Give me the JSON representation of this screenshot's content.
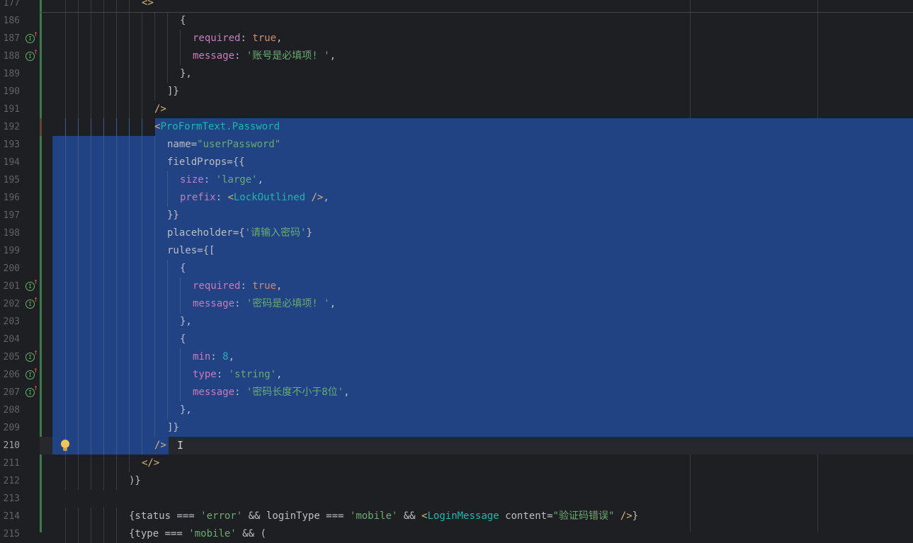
{
  "editor": {
    "lines": [
      {
        "n": "177",
        "indent": 7,
        "tokens": [
          {
            "t": "<>",
            "c": "tag"
          }
        ]
      },
      {
        "n": "186",
        "indent": 10,
        "tokens": [
          {
            "t": "{",
            "c": "punc"
          }
        ]
      },
      {
        "n": "187",
        "indent": 11,
        "marker": true,
        "tokens": [
          {
            "t": "required",
            "c": "key"
          },
          {
            "t": ": ",
            "c": "punc"
          },
          {
            "t": "true",
            "c": "kw"
          },
          {
            "t": ",",
            "c": "punc"
          }
        ]
      },
      {
        "n": "188",
        "indent": 11,
        "marker": true,
        "tokens": [
          {
            "t": "message",
            "c": "key"
          },
          {
            "t": ": ",
            "c": "punc"
          },
          {
            "t": "'账号是必填项! '",
            "c": "str"
          },
          {
            "t": ",",
            "c": "punc"
          }
        ]
      },
      {
        "n": "189",
        "indent": 10,
        "tokens": [
          {
            "t": "},",
            "c": "punc"
          }
        ]
      },
      {
        "n": "190",
        "indent": 9,
        "tokens": [
          {
            "t": "]}",
            "c": "punc"
          }
        ]
      },
      {
        "n": "191",
        "indent": 8,
        "tokens": [
          {
            "t": "/>",
            "c": "tag"
          }
        ]
      },
      {
        "n": "192",
        "indent": 8,
        "selected": true,
        "selStart": 8,
        "tokens": [
          {
            "t": "<",
            "c": "tag"
          },
          {
            "t": "ProFormText.Password",
            "c": "comp"
          }
        ]
      },
      {
        "n": "193",
        "indent": 9,
        "selected": true,
        "tokens": [
          {
            "t": "name",
            "c": "attr"
          },
          {
            "t": "=",
            "c": "punc"
          },
          {
            "t": "\"userPassword\"",
            "c": "str"
          }
        ]
      },
      {
        "n": "194",
        "indent": 9,
        "selected": true,
        "tokens": [
          {
            "t": "fieldProps",
            "c": "attr"
          },
          {
            "t": "={{",
            "c": "punc"
          }
        ]
      },
      {
        "n": "195",
        "indent": 10,
        "selected": true,
        "tokens": [
          {
            "t": "size",
            "c": "key"
          },
          {
            "t": ": ",
            "c": "punc"
          },
          {
            "t": "'large'",
            "c": "str"
          },
          {
            "t": ",",
            "c": "punc"
          }
        ]
      },
      {
        "n": "196",
        "indent": 10,
        "selected": true,
        "tokens": [
          {
            "t": "prefix",
            "c": "key"
          },
          {
            "t": ": ",
            "c": "punc"
          },
          {
            "t": "<",
            "c": "tag"
          },
          {
            "t": "LockOutlined",
            "c": "comp"
          },
          {
            "t": " />",
            "c": "tag"
          },
          {
            "t": ",",
            "c": "punc"
          }
        ]
      },
      {
        "n": "197",
        "indent": 9,
        "selected": true,
        "tokens": [
          {
            "t": "}}",
            "c": "punc"
          }
        ]
      },
      {
        "n": "198",
        "indent": 9,
        "selected": true,
        "tokens": [
          {
            "t": "placeholder",
            "c": "attr"
          },
          {
            "t": "={",
            "c": "punc"
          },
          {
            "t": "'请输入密码'",
            "c": "str"
          },
          {
            "t": "}",
            "c": "punc"
          }
        ]
      },
      {
        "n": "199",
        "indent": 9,
        "selected": true,
        "tokens": [
          {
            "t": "rules",
            "c": "attr"
          },
          {
            "t": "={[",
            "c": "punc"
          }
        ]
      },
      {
        "n": "200",
        "indent": 10,
        "selected": true,
        "tokens": [
          {
            "t": "{",
            "c": "punc"
          }
        ]
      },
      {
        "n": "201",
        "indent": 11,
        "marker": true,
        "selected": true,
        "tokens": [
          {
            "t": "required",
            "c": "key"
          },
          {
            "t": ": ",
            "c": "punc"
          },
          {
            "t": "true",
            "c": "kw"
          },
          {
            "t": ",",
            "c": "punc"
          }
        ]
      },
      {
        "n": "202",
        "indent": 11,
        "marker": true,
        "selected": true,
        "tokens": [
          {
            "t": "message",
            "c": "key"
          },
          {
            "t": ": ",
            "c": "punc"
          },
          {
            "t": "'密码是必填项! '",
            "c": "str"
          },
          {
            "t": ",",
            "c": "punc"
          }
        ]
      },
      {
        "n": "203",
        "indent": 10,
        "selected": true,
        "tokens": [
          {
            "t": "},",
            "c": "punc"
          }
        ]
      },
      {
        "n": "204",
        "indent": 10,
        "selected": true,
        "tokens": [
          {
            "t": "{",
            "c": "punc"
          }
        ]
      },
      {
        "n": "205",
        "indent": 11,
        "marker": true,
        "selected": true,
        "tokens": [
          {
            "t": "min",
            "c": "key"
          },
          {
            "t": ": ",
            "c": "punc"
          },
          {
            "t": "8",
            "c": "num"
          },
          {
            "t": ",",
            "c": "punc"
          }
        ]
      },
      {
        "n": "206",
        "indent": 11,
        "marker": true,
        "selected": true,
        "tokens": [
          {
            "t": "type",
            "c": "key"
          },
          {
            "t": ": ",
            "c": "punc"
          },
          {
            "t": "'string'",
            "c": "str"
          },
          {
            "t": ",",
            "c": "punc"
          }
        ]
      },
      {
        "n": "207",
        "indent": 11,
        "marker": true,
        "selected": true,
        "tokens": [
          {
            "t": "message",
            "c": "key"
          },
          {
            "t": ": ",
            "c": "punc"
          },
          {
            "t": "'密码长度不小于8位'",
            "c": "str"
          },
          {
            "t": ",",
            "c": "punc"
          }
        ]
      },
      {
        "n": "208",
        "indent": 10,
        "selected": true,
        "tokens": [
          {
            "t": "},",
            "c": "punc"
          }
        ]
      },
      {
        "n": "209",
        "indent": 9,
        "selected": true,
        "tokens": [
          {
            "t": "]}",
            "c": "punc"
          }
        ]
      },
      {
        "n": "210",
        "indent": 8,
        "current": true,
        "selected": true,
        "selEnd": 10,
        "bulb": true,
        "caret": true,
        "tokens": [
          {
            "t": "/>",
            "c": "tag"
          }
        ]
      },
      {
        "n": "211",
        "indent": 7,
        "tokens": [
          {
            "t": "</>",
            "c": "tag"
          }
        ]
      },
      {
        "n": "212",
        "indent": 6,
        "tokens": [
          {
            "t": ")}",
            "c": "punc"
          }
        ]
      },
      {
        "n": "213",
        "indent": 0,
        "tokens": []
      },
      {
        "n": "214",
        "indent": 6,
        "tokens": [
          {
            "t": "{status === ",
            "c": "punc"
          },
          {
            "t": "'error'",
            "c": "str"
          },
          {
            "t": " && loginType === ",
            "c": "punc"
          },
          {
            "t": "'mobile'",
            "c": "str"
          },
          {
            "t": " && ",
            "c": "punc"
          },
          {
            "t": "<",
            "c": "tag"
          },
          {
            "t": "LoginMessage",
            "c": "comp"
          },
          {
            "t": " content",
            "c": "attr"
          },
          {
            "t": "=",
            "c": "punc"
          },
          {
            "t": "\"验证码错误\"",
            "c": "str"
          },
          {
            "t": " />",
            "c": "tag"
          },
          {
            "t": "}",
            "c": "punc"
          }
        ]
      },
      {
        "n": "215",
        "indent": 6,
        "tokens": [
          {
            "t": "{type === ",
            "c": "punc"
          },
          {
            "t": "'mobile'",
            "c": "str"
          },
          {
            "t": " && (",
            "c": "punc"
          }
        ]
      }
    ]
  }
}
